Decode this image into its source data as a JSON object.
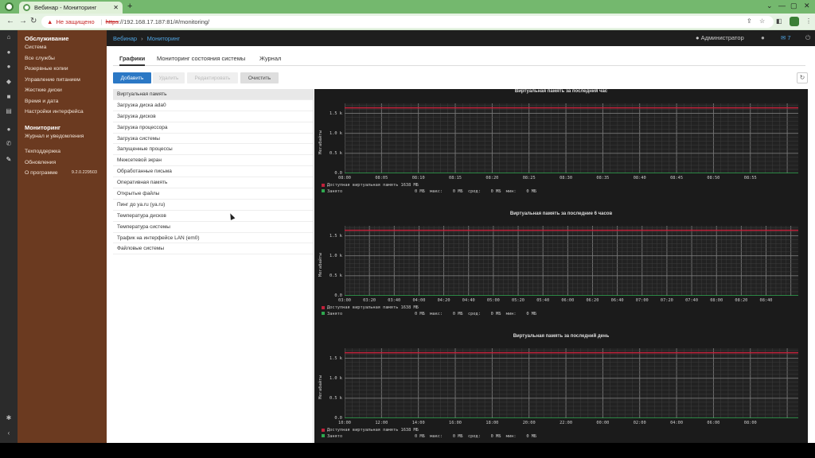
{
  "browser": {
    "tab_title": "Вебинар - Мониторинг",
    "warning": "Не защищено",
    "url_scheme": "https",
    "url_rest": "://192.168.17.187:81/#/monitoring/"
  },
  "sidebar": {
    "sections": [
      {
        "title": "Обслуживание",
        "items": [
          "Система",
          "Все службы",
          "Резервные копии",
          "Управление питанием",
          "Жесткие диски",
          "Время и дата",
          "Настройки интерфейса"
        ]
      },
      {
        "title": "Мониторинг",
        "items": [
          "Журнал и уведомления"
        ]
      }
    ],
    "extra_items": [
      "Техподдержка",
      "Обновления"
    ],
    "about_label": "О программе",
    "version": "9.2.0.229503"
  },
  "header": {
    "breadcrumb_root": "Вебинар",
    "breadcrumb_current": "Мониторинг",
    "user": "Администратор",
    "messages_count": "7"
  },
  "tabs": [
    "Графики",
    "Мониторинг состояния системы",
    "Журнал"
  ],
  "buttons": {
    "add": "Добавить",
    "delete": "Удалить",
    "edit": "Редактировать",
    "clear": "Очистить"
  },
  "chart_list": [
    "Виртуальная память",
    "Загрузка диска ada0",
    "Загрузка дисков",
    "Загрузка процессора",
    "Загрузка системы",
    "Запущенные процессы",
    "Межсетевой экран",
    "Обработанные письма",
    "Оперативная память",
    "Открытые файлы",
    "Пинг до ya.ru (ya.ru)",
    "Температура дисков",
    "Температура системы",
    "Трафик на интерфейсе LAN (em0)",
    "Файловые системы"
  ],
  "colors": {
    "available": "#c0213a",
    "used": "#2fa84f",
    "accent": "#2b78c5",
    "sidebar": "#6b3a20"
  },
  "chart_data": [
    {
      "type": "line",
      "title": "Виртуальная память за последний час",
      "ylabel": "Мегабайты",
      "yticks": [
        "0.0",
        "0.5 k",
        "1.0 k",
        "1.5 k"
      ],
      "x": [
        "08:00",
        "08:05",
        "08:10",
        "08:15",
        "08:20",
        "08:25",
        "08:30",
        "08:35",
        "08:40",
        "08:45",
        "08:50",
        "08:55"
      ],
      "ylim": [
        0,
        1750
      ],
      "series": [
        {
          "name": "Доступная виртуальная память",
          "value": 1638,
          "label": "1638 МБ"
        },
        {
          "name": "Занято",
          "value": 0,
          "stats": "0 МБ  макс:    0 МБ  сред:    0 МБ  мин:    0 МБ"
        }
      ]
    },
    {
      "type": "line",
      "title": "Виртуальная память за последние 6 часов",
      "ylabel": "Мегабайты",
      "yticks": [
        "0.0",
        "0.5 k",
        "1.0 k",
        "1.5 k"
      ],
      "x": [
        "03:00",
        "03:20",
        "03:40",
        "04:00",
        "04:20",
        "04:40",
        "05:00",
        "05:20",
        "05:40",
        "06:00",
        "06:20",
        "06:40",
        "07:00",
        "07:20",
        "07:40",
        "08:00",
        "08:20",
        "08:40"
      ],
      "ylim": [
        0,
        1750
      ],
      "series": [
        {
          "name": "Доступная виртуальная память",
          "value": 1638,
          "label": "1638 МБ"
        },
        {
          "name": "Занято",
          "value": 0,
          "stats": "0 МБ  макс:    0 МБ  сред:    0 МБ  мин:    0 МБ"
        }
      ]
    },
    {
      "type": "line",
      "title": "Виртуальная память за последний день",
      "ylabel": "Мегабайты",
      "yticks": [
        "0.0",
        "0.5 k",
        "1.0 k",
        "1.5 k"
      ],
      "x": [
        "10:00",
        "12:00",
        "14:00",
        "16:00",
        "18:00",
        "20:00",
        "22:00",
        "00:00",
        "02:00",
        "04:00",
        "06:00",
        "08:00"
      ],
      "ylim": [
        0,
        1750
      ],
      "series": [
        {
          "name": "Доступная виртуальная память",
          "value": 1638,
          "label": "1638 МБ"
        },
        {
          "name": "Занято",
          "value": 0,
          "stats": "0 МБ  макс:    0 МБ  сред:    0 МБ  мин:    0 МБ"
        }
      ]
    }
  ]
}
